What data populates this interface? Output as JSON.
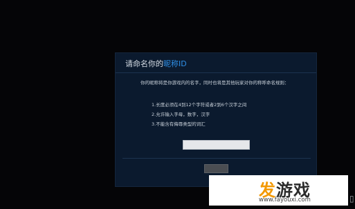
{
  "dialog": {
    "title_prefix": "请命名你的",
    "title_highlight": "昵称ID",
    "intro": "你的昵称将是你游戏内的名字，同时也将是其他玩家对你的称呼命名规则：",
    "rules": [
      "1.长度必须在4到12个字符或者2到6个汉字之间",
      "2.允许输入字母，数字，汉字",
      "3.不能含有侮辱类型的词汇"
    ],
    "name_input_value": "",
    "ok_button_label": ""
  },
  "watermark": {
    "logo_highlight": "发",
    "logo_text": "游戏",
    "url": "www.fayouxi.com"
  },
  "corner_icon": "b-icon",
  "colors": {
    "background": "#050507",
    "dialog_bg": "#0b1a2e",
    "highlight_blue": "#2f8fe6",
    "logo_orange": "#f39800"
  }
}
